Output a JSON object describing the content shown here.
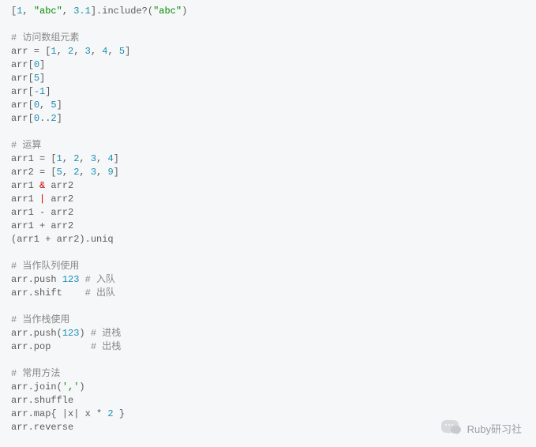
{
  "code": {
    "l1_a": "[",
    "l1_n1": "1",
    "l1_b": ", ",
    "l1_s1": "\"abc\"",
    "l1_c": ", ",
    "l1_n2": "3.1",
    "l1_d": "].include?(",
    "l1_s2": "\"abc\"",
    "l1_e": ")",
    "c_access": "# 访问数组元素",
    "l3_a": "arr = [",
    "l3_n1": "1",
    "l3_b": ", ",
    "l3_n2": "2",
    "l3_c": ", ",
    "l3_n3": "3",
    "l3_d": ", ",
    "l3_n4": "4",
    "l3_e": ", ",
    "l3_n5": "5",
    "l3_f": "]",
    "l4_a": "arr[",
    "l4_n": "0",
    "l4_b": "]",
    "l5_a": "arr[",
    "l5_n": "5",
    "l5_b": "]",
    "l6_a": "arr[",
    "l6_n": "-1",
    "l6_b": "]",
    "l7_a": "arr[",
    "l7_n1": "0",
    "l7_b": ", ",
    "l7_n2": "5",
    "l7_c": "]",
    "l8_a": "arr[",
    "l8_n1": "0",
    "l8_b": "..",
    "l8_n2": "2",
    "l8_c": "]",
    "c_op": "# 运算",
    "l10_a": "arr1 = [",
    "l10_n1": "1",
    "l10_b": ", ",
    "l10_n2": "2",
    "l10_c": ", ",
    "l10_n3": "3",
    "l10_d": ", ",
    "l10_n4": "4",
    "l10_e": "]",
    "l11_a": "arr2 = [",
    "l11_n1": "5",
    "l11_b": ", ",
    "l11_n2": "2",
    "l11_c": ", ",
    "l11_n3": "3",
    "l11_d": ", ",
    "l11_n4": "9",
    "l11_e": "]",
    "l12_a": "arr1 ",
    "l12_op": "&",
    "l12_b": " arr2",
    "l13_a": "arr1 ",
    "l13_op": "|",
    "l13_b": " arr2",
    "l14": "arr1 - arr2",
    "l15": "arr1 + arr2",
    "l16": "(arr1 + arr2).uniq",
    "c_queue": "# 当作队列使用",
    "l18_a": "arr.push ",
    "l18_n": "123",
    "l18_b": " ",
    "l18_c": "# 入队",
    "l19_a": "arr.shift    ",
    "l19_c": "# 出队",
    "c_stack": "# 当作栈使用",
    "l21_a": "arr.push(",
    "l21_n": "123",
    "l21_b": ") ",
    "l21_c": "# 进栈",
    "l22_a": "arr.pop       ",
    "l22_c": "# 出栈",
    "c_common": "# 常用方法",
    "l24_a": "arr.join(",
    "l24_s": "','",
    "l24_b": ")",
    "l25": "arr.shuffle",
    "l26_a": "arr.map{ |x| x * ",
    "l26_n": "2",
    "l26_b": " }",
    "l27": "arr.reverse"
  },
  "watermark": {
    "label": "Ruby研习社"
  }
}
